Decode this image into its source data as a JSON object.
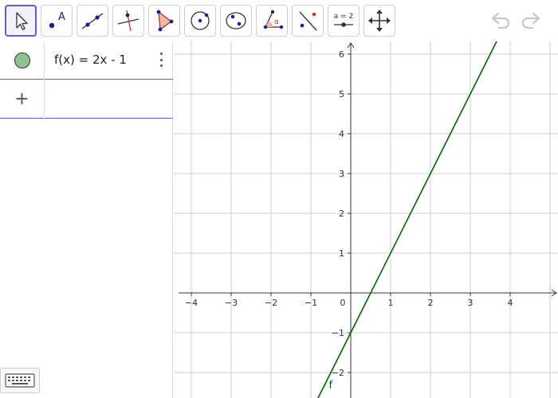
{
  "toolbar": {
    "tools": [
      {
        "name": "move-tool",
        "active": true
      },
      {
        "name": "point-tool",
        "label": "A"
      },
      {
        "name": "line-tool"
      },
      {
        "name": "perpendicular-line-tool"
      },
      {
        "name": "polygon-tool"
      },
      {
        "name": "circle-center-point-tool"
      },
      {
        "name": "conic-five-points-tool"
      },
      {
        "name": "angle-tool",
        "label": "α"
      },
      {
        "name": "reflect-tool"
      },
      {
        "name": "slider-tool",
        "label": "a = 2"
      },
      {
        "name": "move-graphics-view-tool"
      }
    ],
    "undo_icon": "undo-icon",
    "redo_icon": "redo-icon"
  },
  "algebra": {
    "items": [
      {
        "formula": "f(x) = 2x - 1",
        "color": "#8fc28f"
      }
    ],
    "input_plus": "+"
  },
  "graph": {
    "function_label": "f",
    "line_color": "#006400",
    "x_ticks": [
      "−4",
      "−3",
      "−2",
      "−1",
      "0",
      "1",
      "2",
      "3",
      "4"
    ],
    "y_ticks": [
      "6",
      "5",
      "4",
      "3",
      "2",
      "1",
      "−1",
      "−2"
    ],
    "slope": 2,
    "intercept": -1
  },
  "chart_data": {
    "type": "line",
    "series": [
      {
        "name": "f",
        "x": [
          -0.75,
          3.65
        ],
        "y": [
          -2.5,
          6.3
        ]
      }
    ],
    "xlim": [
      -4.3,
      4.2
    ],
    "ylim": [
      -2.4,
      6.2
    ],
    "grid": true
  }
}
